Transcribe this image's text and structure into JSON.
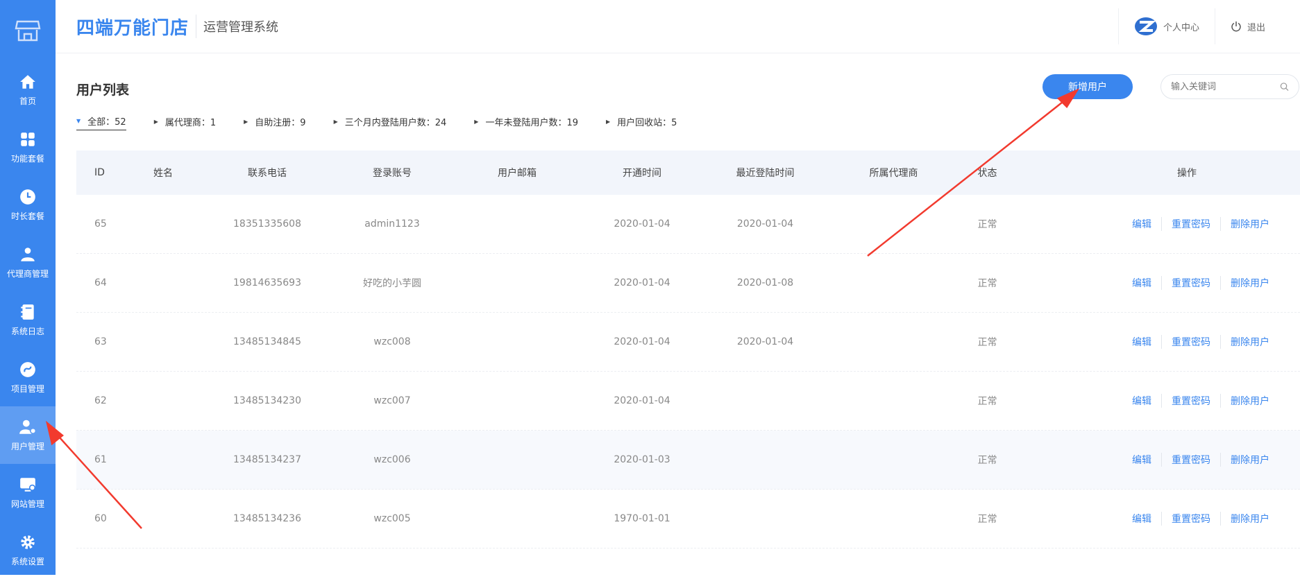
{
  "sidebar": {
    "items": [
      {
        "label": "首页",
        "icon": "home-icon"
      },
      {
        "label": "功能套餐",
        "icon": "grid-icon"
      },
      {
        "label": "时长套餐",
        "icon": "clock-icon"
      },
      {
        "label": "代理商管理",
        "icon": "agent-icon"
      },
      {
        "label": "系统日志",
        "icon": "log-icon"
      },
      {
        "label": "项目管理",
        "icon": "project-icon"
      },
      {
        "label": "用户管理",
        "icon": "user-manage-icon"
      },
      {
        "label": "网站管理",
        "icon": "website-icon"
      },
      {
        "label": "系统设置",
        "icon": "settings-icon"
      }
    ],
    "active_index": 6
  },
  "header": {
    "brand": "四端万能门店",
    "subtitle": "运营管理系统",
    "user_center": "个人中心",
    "logout": "退出"
  },
  "page": {
    "title": "用户列表",
    "add_button": "新增用户",
    "search_placeholder": "输入关键词"
  },
  "filters": [
    "全部：52",
    "属代理商：1",
    "自助注册：9",
    "三个月内登陆用户数：24",
    "一年未登陆用户数：19",
    "用户回收站：5"
  ],
  "table": {
    "columns": [
      "ID",
      "姓名",
      "联系电话",
      "登录账号",
      "用户邮箱",
      "开通时间",
      "最近登陆时间",
      "所属代理商",
      "状态",
      "操作"
    ],
    "ops": [
      "编辑",
      "重置密码",
      "删除用户"
    ],
    "rows": [
      {
        "id": "65",
        "name": "",
        "phone": "18351335608",
        "account": "admin1123",
        "email": "",
        "opened": "2020-01-04",
        "last_login": "2020-01-04",
        "agent": "",
        "status": "正常"
      },
      {
        "id": "64",
        "name": "",
        "phone": "19814635693",
        "account": "好吃的小芋圆",
        "email": "",
        "opened": "2020-01-04",
        "last_login": "2020-01-08",
        "agent": "",
        "status": "正常"
      },
      {
        "id": "63",
        "name": "",
        "phone": "13485134845",
        "account": "wzc008",
        "email": "",
        "opened": "2020-01-04",
        "last_login": "2020-01-04",
        "agent": "",
        "status": "正常"
      },
      {
        "id": "62",
        "name": "",
        "phone": "13485134230",
        "account": "wzc007",
        "email": "",
        "opened": "2020-01-04",
        "last_login": "",
        "agent": "",
        "status": "正常"
      },
      {
        "id": "61",
        "name": "",
        "phone": "13485134237",
        "account": "wzc006",
        "email": "",
        "opened": "2020-01-03",
        "last_login": "",
        "agent": "",
        "status": "正常"
      },
      {
        "id": "60",
        "name": "",
        "phone": "13485134236",
        "account": "wzc005",
        "email": "",
        "opened": "1970-01-01",
        "last_login": "",
        "agent": "",
        "status": "正常"
      }
    ]
  },
  "colors": {
    "accent": "#3a86ee",
    "annotation_arrow": "#f23a2e"
  }
}
